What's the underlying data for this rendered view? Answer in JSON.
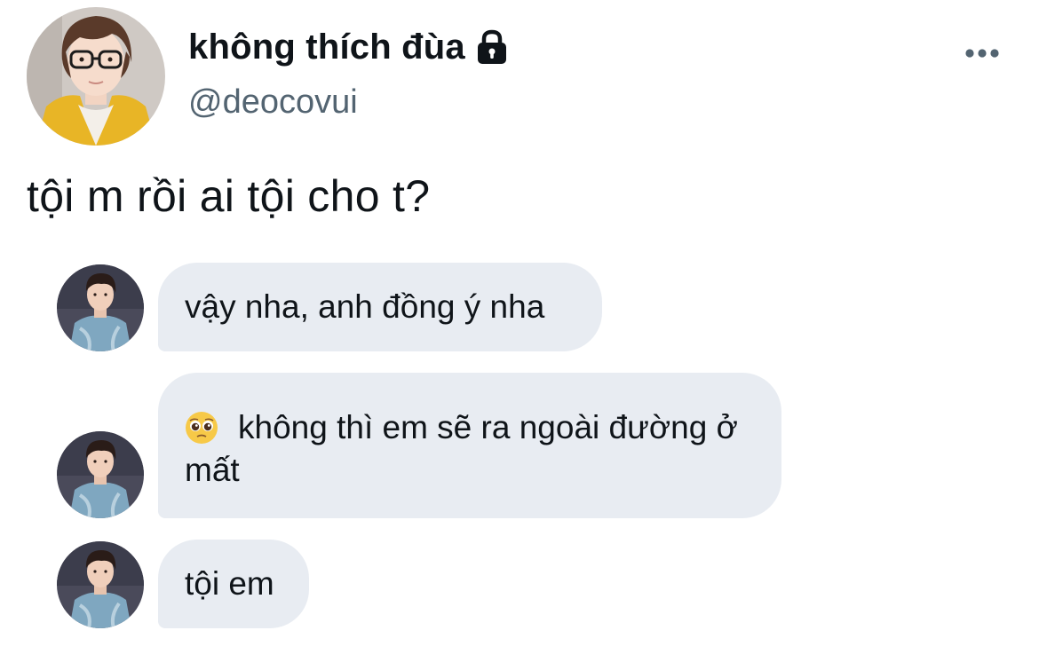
{
  "author": {
    "display_name": "không thích đùa",
    "handle": "@deocovui",
    "protected_icon": "lock-icon",
    "avatar": "avatar-photo"
  },
  "menu": {
    "icon": "more-horizontal-icon"
  },
  "tweet": {
    "text": "tội m rồi ai tội cho t?"
  },
  "chat": {
    "avatar": "avatar-photo",
    "messages": [
      {
        "text": "vậy nha, anh đồng ý nha"
      },
      {
        "emoji": "pleading-face-emoji",
        "text": "không thì em sẽ ra ngoài đường ở mất"
      },
      {
        "text": "tội em"
      }
    ]
  },
  "colors": {
    "text": "#0f1419",
    "secondary_text": "#536471",
    "bubble_background": "#e8ecf2",
    "background": "#ffffff"
  }
}
